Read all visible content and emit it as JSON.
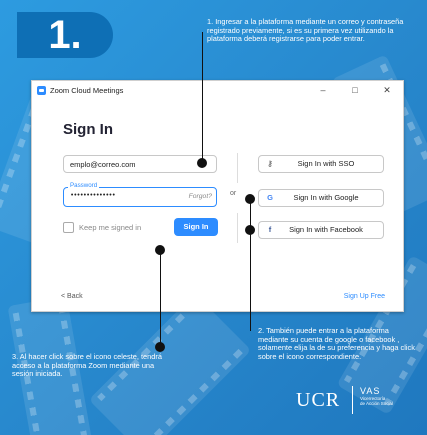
{
  "step_number": "1.",
  "notes": {
    "n1": "1. Ingresar a la plataforma mediante un correo y contraseña registrado previamente, si es su primera vez utilizando la plataforma deberá registrarse para poder entrar.",
    "n2": "2. También puede entrar a la plataforma mediante su cuenta de google o facebook , solamente elija la de su preferencia y haga click sobre el icono correspondiente.",
    "n3": "3. Al hacer click sobre el icono celeste, tendrá acceso a la plataforma Zoom mediante una sesión iniciada."
  },
  "window": {
    "title": "Zoom Cloud Meetings",
    "minimize": "–",
    "maximize": "□",
    "close": "✕"
  },
  "signin": {
    "heading": "Sign In",
    "email_value": "emplo@correo.com",
    "password_label": "Password",
    "password_value": "••••••••••••••",
    "forgot": "Forgot?",
    "keep_signed_in": "Keep me signed in",
    "button": "Sign In",
    "or": "or",
    "sso": "Sign In with SSO",
    "google": "Sign In with Google",
    "facebook": "Sign In with Facebook",
    "back": "< Back",
    "signup": "Sign Up Free"
  },
  "icons": {
    "sso": "key-icon",
    "google": "google-icon",
    "facebook": "facebook-icon",
    "app": "zoom-logo-icon"
  },
  "colors": {
    "accent": "#2d8cff",
    "badge": "#0e6fb5",
    "background": "#2787cc"
  },
  "footer": {
    "ucr": "UCR",
    "vas": "VAS",
    "vas_sub1": "Vicerrectoría",
    "vas_sub2": "de Acción Social"
  }
}
